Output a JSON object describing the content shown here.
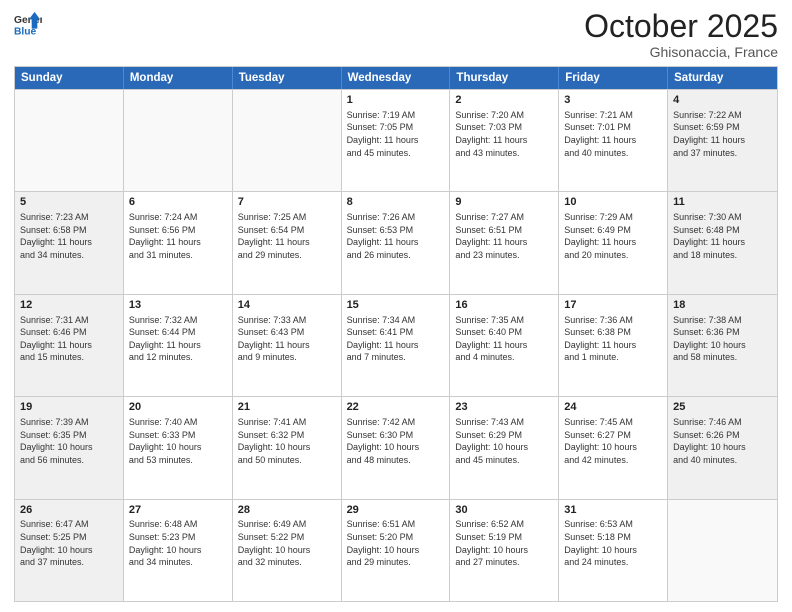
{
  "header": {
    "logo_general": "General",
    "logo_blue": "Blue",
    "month": "October 2025",
    "location": "Ghisonaccia, France"
  },
  "days_of_week": [
    "Sunday",
    "Monday",
    "Tuesday",
    "Wednesday",
    "Thursday",
    "Friday",
    "Saturday"
  ],
  "weeks": [
    [
      {
        "day": "",
        "empty": true
      },
      {
        "day": "",
        "empty": true
      },
      {
        "day": "",
        "empty": true
      },
      {
        "day": "1",
        "lines": [
          "Sunrise: 7:19 AM",
          "Sunset: 7:05 PM",
          "Daylight: 11 hours",
          "and 45 minutes."
        ]
      },
      {
        "day": "2",
        "lines": [
          "Sunrise: 7:20 AM",
          "Sunset: 7:03 PM",
          "Daylight: 11 hours",
          "and 43 minutes."
        ]
      },
      {
        "day": "3",
        "lines": [
          "Sunrise: 7:21 AM",
          "Sunset: 7:01 PM",
          "Daylight: 11 hours",
          "and 40 minutes."
        ]
      },
      {
        "day": "4",
        "shade": true,
        "lines": [
          "Sunrise: 7:22 AM",
          "Sunset: 6:59 PM",
          "Daylight: 11 hours",
          "and 37 minutes."
        ]
      }
    ],
    [
      {
        "day": "5",
        "shade": true,
        "lines": [
          "Sunrise: 7:23 AM",
          "Sunset: 6:58 PM",
          "Daylight: 11 hours",
          "and 34 minutes."
        ]
      },
      {
        "day": "6",
        "lines": [
          "Sunrise: 7:24 AM",
          "Sunset: 6:56 PM",
          "Daylight: 11 hours",
          "and 31 minutes."
        ]
      },
      {
        "day": "7",
        "lines": [
          "Sunrise: 7:25 AM",
          "Sunset: 6:54 PM",
          "Daylight: 11 hours",
          "and 29 minutes."
        ]
      },
      {
        "day": "8",
        "lines": [
          "Sunrise: 7:26 AM",
          "Sunset: 6:53 PM",
          "Daylight: 11 hours",
          "and 26 minutes."
        ]
      },
      {
        "day": "9",
        "lines": [
          "Sunrise: 7:27 AM",
          "Sunset: 6:51 PM",
          "Daylight: 11 hours",
          "and 23 minutes."
        ]
      },
      {
        "day": "10",
        "lines": [
          "Sunrise: 7:29 AM",
          "Sunset: 6:49 PM",
          "Daylight: 11 hours",
          "and 20 minutes."
        ]
      },
      {
        "day": "11",
        "shade": true,
        "lines": [
          "Sunrise: 7:30 AM",
          "Sunset: 6:48 PM",
          "Daylight: 11 hours",
          "and 18 minutes."
        ]
      }
    ],
    [
      {
        "day": "12",
        "shade": true,
        "lines": [
          "Sunrise: 7:31 AM",
          "Sunset: 6:46 PM",
          "Daylight: 11 hours",
          "and 15 minutes."
        ]
      },
      {
        "day": "13",
        "lines": [
          "Sunrise: 7:32 AM",
          "Sunset: 6:44 PM",
          "Daylight: 11 hours",
          "and 12 minutes."
        ]
      },
      {
        "day": "14",
        "lines": [
          "Sunrise: 7:33 AM",
          "Sunset: 6:43 PM",
          "Daylight: 11 hours",
          "and 9 minutes."
        ]
      },
      {
        "day": "15",
        "lines": [
          "Sunrise: 7:34 AM",
          "Sunset: 6:41 PM",
          "Daylight: 11 hours",
          "and 7 minutes."
        ]
      },
      {
        "day": "16",
        "lines": [
          "Sunrise: 7:35 AM",
          "Sunset: 6:40 PM",
          "Daylight: 11 hours",
          "and 4 minutes."
        ]
      },
      {
        "day": "17",
        "lines": [
          "Sunrise: 7:36 AM",
          "Sunset: 6:38 PM",
          "Daylight: 11 hours",
          "and 1 minute."
        ]
      },
      {
        "day": "18",
        "shade": true,
        "lines": [
          "Sunrise: 7:38 AM",
          "Sunset: 6:36 PM",
          "Daylight: 10 hours",
          "and 58 minutes."
        ]
      }
    ],
    [
      {
        "day": "19",
        "shade": true,
        "lines": [
          "Sunrise: 7:39 AM",
          "Sunset: 6:35 PM",
          "Daylight: 10 hours",
          "and 56 minutes."
        ]
      },
      {
        "day": "20",
        "lines": [
          "Sunrise: 7:40 AM",
          "Sunset: 6:33 PM",
          "Daylight: 10 hours",
          "and 53 minutes."
        ]
      },
      {
        "day": "21",
        "lines": [
          "Sunrise: 7:41 AM",
          "Sunset: 6:32 PM",
          "Daylight: 10 hours",
          "and 50 minutes."
        ]
      },
      {
        "day": "22",
        "lines": [
          "Sunrise: 7:42 AM",
          "Sunset: 6:30 PM",
          "Daylight: 10 hours",
          "and 48 minutes."
        ]
      },
      {
        "day": "23",
        "lines": [
          "Sunrise: 7:43 AM",
          "Sunset: 6:29 PM",
          "Daylight: 10 hours",
          "and 45 minutes."
        ]
      },
      {
        "day": "24",
        "lines": [
          "Sunrise: 7:45 AM",
          "Sunset: 6:27 PM",
          "Daylight: 10 hours",
          "and 42 minutes."
        ]
      },
      {
        "day": "25",
        "shade": true,
        "lines": [
          "Sunrise: 7:46 AM",
          "Sunset: 6:26 PM",
          "Daylight: 10 hours",
          "and 40 minutes."
        ]
      }
    ],
    [
      {
        "day": "26",
        "shade": true,
        "lines": [
          "Sunrise: 6:47 AM",
          "Sunset: 5:25 PM",
          "Daylight: 10 hours",
          "and 37 minutes."
        ]
      },
      {
        "day": "27",
        "lines": [
          "Sunrise: 6:48 AM",
          "Sunset: 5:23 PM",
          "Daylight: 10 hours",
          "and 34 minutes."
        ]
      },
      {
        "day": "28",
        "lines": [
          "Sunrise: 6:49 AM",
          "Sunset: 5:22 PM",
          "Daylight: 10 hours",
          "and 32 minutes."
        ]
      },
      {
        "day": "29",
        "lines": [
          "Sunrise: 6:51 AM",
          "Sunset: 5:20 PM",
          "Daylight: 10 hours",
          "and 29 minutes."
        ]
      },
      {
        "day": "30",
        "lines": [
          "Sunrise: 6:52 AM",
          "Sunset: 5:19 PM",
          "Daylight: 10 hours",
          "and 27 minutes."
        ]
      },
      {
        "day": "31",
        "lines": [
          "Sunrise: 6:53 AM",
          "Sunset: 5:18 PM",
          "Daylight: 10 hours",
          "and 24 minutes."
        ]
      },
      {
        "day": "",
        "empty": true,
        "shade": true
      }
    ]
  ]
}
